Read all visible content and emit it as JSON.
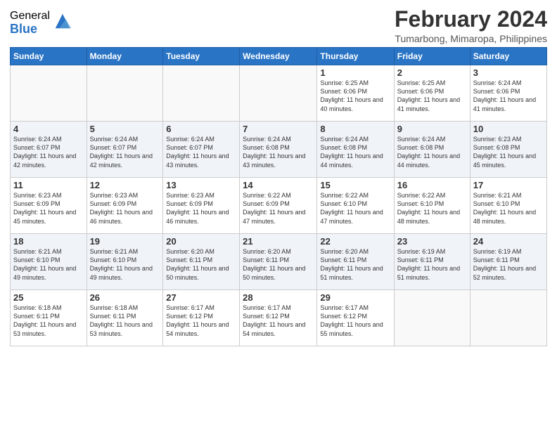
{
  "logo": {
    "general": "General",
    "blue": "Blue"
  },
  "title": "February 2024",
  "subtitle": "Tumarbong, Mimaropa, Philippines",
  "weekdays": [
    "Sunday",
    "Monday",
    "Tuesday",
    "Wednesday",
    "Thursday",
    "Friday",
    "Saturday"
  ],
  "weeks": [
    [
      {
        "day": "",
        "info": ""
      },
      {
        "day": "",
        "info": ""
      },
      {
        "day": "",
        "info": ""
      },
      {
        "day": "",
        "info": ""
      },
      {
        "day": "1",
        "info": "Sunrise: 6:25 AM\nSunset: 6:06 PM\nDaylight: 11 hours and 40 minutes."
      },
      {
        "day": "2",
        "info": "Sunrise: 6:25 AM\nSunset: 6:06 PM\nDaylight: 11 hours and 41 minutes."
      },
      {
        "day": "3",
        "info": "Sunrise: 6:24 AM\nSunset: 6:06 PM\nDaylight: 11 hours and 41 minutes."
      }
    ],
    [
      {
        "day": "4",
        "info": "Sunrise: 6:24 AM\nSunset: 6:07 PM\nDaylight: 11 hours and 42 minutes."
      },
      {
        "day": "5",
        "info": "Sunrise: 6:24 AM\nSunset: 6:07 PM\nDaylight: 11 hours and 42 minutes."
      },
      {
        "day": "6",
        "info": "Sunrise: 6:24 AM\nSunset: 6:07 PM\nDaylight: 11 hours and 43 minutes."
      },
      {
        "day": "7",
        "info": "Sunrise: 6:24 AM\nSunset: 6:08 PM\nDaylight: 11 hours and 43 minutes."
      },
      {
        "day": "8",
        "info": "Sunrise: 6:24 AM\nSunset: 6:08 PM\nDaylight: 11 hours and 44 minutes."
      },
      {
        "day": "9",
        "info": "Sunrise: 6:24 AM\nSunset: 6:08 PM\nDaylight: 11 hours and 44 minutes."
      },
      {
        "day": "10",
        "info": "Sunrise: 6:23 AM\nSunset: 6:08 PM\nDaylight: 11 hours and 45 minutes."
      }
    ],
    [
      {
        "day": "11",
        "info": "Sunrise: 6:23 AM\nSunset: 6:09 PM\nDaylight: 11 hours and 45 minutes."
      },
      {
        "day": "12",
        "info": "Sunrise: 6:23 AM\nSunset: 6:09 PM\nDaylight: 11 hours and 46 minutes."
      },
      {
        "day": "13",
        "info": "Sunrise: 6:23 AM\nSunset: 6:09 PM\nDaylight: 11 hours and 46 minutes."
      },
      {
        "day": "14",
        "info": "Sunrise: 6:22 AM\nSunset: 6:09 PM\nDaylight: 11 hours and 47 minutes."
      },
      {
        "day": "15",
        "info": "Sunrise: 6:22 AM\nSunset: 6:10 PM\nDaylight: 11 hours and 47 minutes."
      },
      {
        "day": "16",
        "info": "Sunrise: 6:22 AM\nSunset: 6:10 PM\nDaylight: 11 hours and 48 minutes."
      },
      {
        "day": "17",
        "info": "Sunrise: 6:21 AM\nSunset: 6:10 PM\nDaylight: 11 hours and 48 minutes."
      }
    ],
    [
      {
        "day": "18",
        "info": "Sunrise: 6:21 AM\nSunset: 6:10 PM\nDaylight: 11 hours and 49 minutes."
      },
      {
        "day": "19",
        "info": "Sunrise: 6:21 AM\nSunset: 6:10 PM\nDaylight: 11 hours and 49 minutes."
      },
      {
        "day": "20",
        "info": "Sunrise: 6:20 AM\nSunset: 6:11 PM\nDaylight: 11 hours and 50 minutes."
      },
      {
        "day": "21",
        "info": "Sunrise: 6:20 AM\nSunset: 6:11 PM\nDaylight: 11 hours and 50 minutes."
      },
      {
        "day": "22",
        "info": "Sunrise: 6:20 AM\nSunset: 6:11 PM\nDaylight: 11 hours and 51 minutes."
      },
      {
        "day": "23",
        "info": "Sunrise: 6:19 AM\nSunset: 6:11 PM\nDaylight: 11 hours and 51 minutes."
      },
      {
        "day": "24",
        "info": "Sunrise: 6:19 AM\nSunset: 6:11 PM\nDaylight: 11 hours and 52 minutes."
      }
    ],
    [
      {
        "day": "25",
        "info": "Sunrise: 6:18 AM\nSunset: 6:11 PM\nDaylight: 11 hours and 53 minutes."
      },
      {
        "day": "26",
        "info": "Sunrise: 6:18 AM\nSunset: 6:11 PM\nDaylight: 11 hours and 53 minutes."
      },
      {
        "day": "27",
        "info": "Sunrise: 6:17 AM\nSunset: 6:12 PM\nDaylight: 11 hours and 54 minutes."
      },
      {
        "day": "28",
        "info": "Sunrise: 6:17 AM\nSunset: 6:12 PM\nDaylight: 11 hours and 54 minutes."
      },
      {
        "day": "29",
        "info": "Sunrise: 6:17 AM\nSunset: 6:12 PM\nDaylight: 11 hours and 55 minutes."
      },
      {
        "day": "",
        "info": ""
      },
      {
        "day": "",
        "info": ""
      }
    ]
  ]
}
